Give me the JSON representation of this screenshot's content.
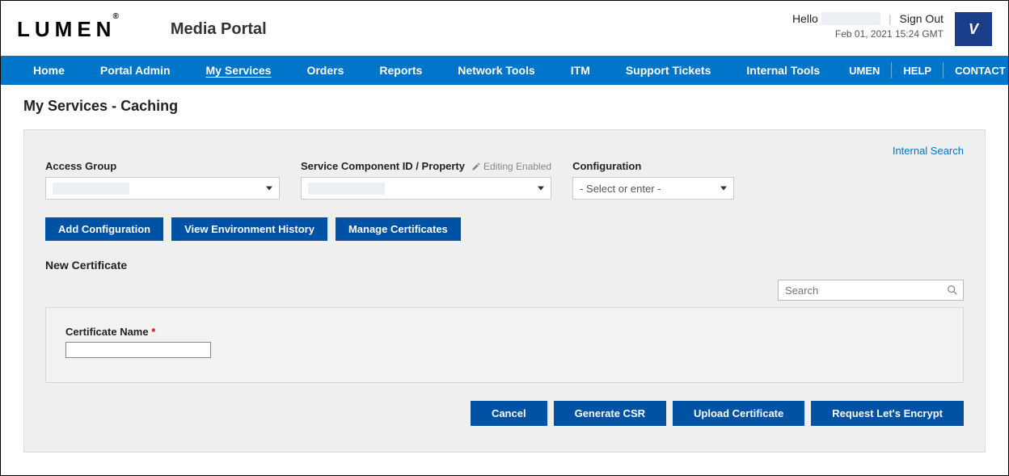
{
  "header": {
    "brand": "LUMEN",
    "portal_title": "Media Portal",
    "hello_prefix": "Hello",
    "username_masked": "██████",
    "sign_out": "Sign Out",
    "timestamp": "Feb 01, 2021 15:24 GMT",
    "vlogo_text": "Vyvx"
  },
  "nav": {
    "items": [
      "Home",
      "Portal Admin",
      "My Services",
      "Orders",
      "Reports",
      "Network Tools",
      "ITM",
      "Support Tickets",
      "Internal Tools"
    ],
    "active_index": 2,
    "right": {
      "umen": "UMEN",
      "help": "HELP",
      "contact": "CONTACT US"
    }
  },
  "page": {
    "title": "My Services - Caching",
    "internal_search": "Internal Search",
    "filters": {
      "access_group": {
        "label": "Access Group",
        "value_masked": "██████"
      },
      "service_component": {
        "label": "Service Component ID / Property",
        "editing_enabled": "Editing Enabled",
        "value_masked": "██████"
      },
      "configuration": {
        "label": "Configuration",
        "placeholder": "- Select or enter -"
      }
    },
    "buttons": {
      "add_config": "Add Configuration",
      "view_env_history": "View Environment History",
      "manage_certs": "Manage Certificates"
    },
    "new_cert_heading": "New Certificate",
    "search_placeholder": "Search",
    "cert_form": {
      "name_label": "Certificate Name",
      "required_marker": "*",
      "name_value": ""
    },
    "footer": {
      "cancel": "Cancel",
      "generate_csr": "Generate CSR",
      "upload_cert": "Upload Certificate",
      "request_le": "Request Let's Encrypt"
    }
  }
}
